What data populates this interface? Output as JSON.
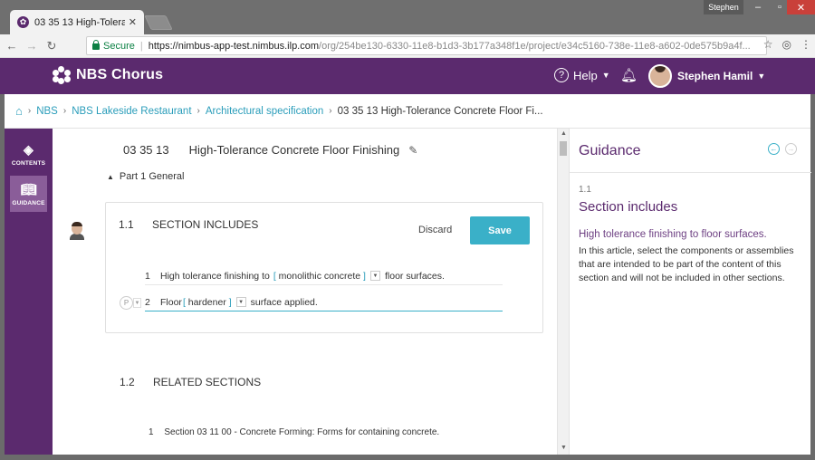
{
  "browser": {
    "tab_title": "03 35 13 High-Tolerance",
    "tab_close": "✕",
    "user_chip": "Stephen",
    "win_min": "‒",
    "win_max": "▫",
    "win_close": "✕",
    "secure_label": "Secure",
    "url_host": "https://nimbus-app-test.nimbus.ilp.com",
    "url_path": "/org/254be130-6330-11e8-b1d3-3b177a348f1e/project/e34c5160-738e-11e8-a602-0de575b9a4f..."
  },
  "header": {
    "logo_text": "NBS Chorus",
    "help_label": "Help",
    "user_name": "Stephen Hamil"
  },
  "breadcrumb": {
    "items": [
      "NBS",
      "NBS Lakeside Restaurant",
      "Architectural specification"
    ],
    "current": "03 35 13 High-Tolerance Concrete Floor Fi..."
  },
  "rail": {
    "contents_label": "CONTENTS",
    "guidance_label": "GUIDANCE"
  },
  "document": {
    "number": "03 35 13",
    "title": "High-Tolerance Concrete Floor Finishing",
    "part_label": "Part 1 General",
    "clause": {
      "number": "1.1",
      "title": "SECTION INCLUDES",
      "discard_label": "Discard",
      "save_label": "Save",
      "lines": [
        {
          "num": "1",
          "pre": "High tolerance finishing to",
          "placeholder": "monolithic concrete",
          "post": "floor surfaces."
        },
        {
          "num": "2",
          "pre": "Floor",
          "placeholder": "hardener",
          "post": "surface applied."
        }
      ],
      "tag_label": "P"
    },
    "clause2": {
      "number": "1.2",
      "title": "RELATED SECTIONS",
      "line_num": "1",
      "line_text": "Section 03 11 00 - Concrete Forming: Forms for containing concrete."
    }
  },
  "guidance": {
    "title": "Guidance",
    "section_number": "1.1",
    "section_title": "Section includes",
    "subtitle": "High tolerance finishing to floor surfaces.",
    "body": "In this article, select the components or assemblies that are intended to be part of the content of this section and will not be included in other sections."
  }
}
